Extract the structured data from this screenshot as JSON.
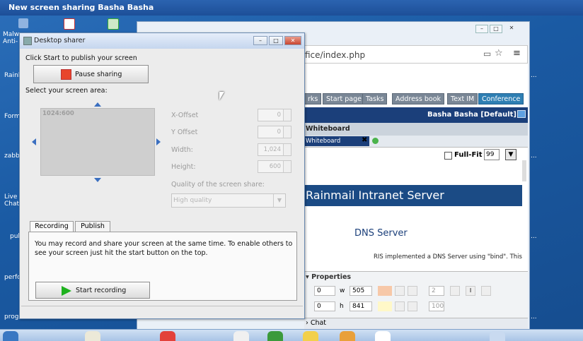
{
  "session_title": "New screen sharing  Basha Basha",
  "desktop": {
    "labels": [
      "Malw\nAnti-",
      "Rainl",
      "Form",
      "zabbi",
      "Live\nChat",
      "pul",
      "perfo",
      "proge"
    ]
  },
  "browser": {
    "url": "fice/index.php",
    "nav_tabs": [
      "rks",
      "Start page",
      "Tasks",
      "Address book",
      "Text IM",
      "Conference"
    ],
    "user": "Basha Basha [Default]",
    "whiteboard_header": "Whiteboard",
    "whiteboard_tab": "Whiteboard",
    "full_fit_label": "Full-Fit",
    "zoom_value": "99",
    "banner_text": "Rainmail Intranet Server",
    "section_title": "DNS Server",
    "body_line1": "RIS implemented a DNS Server using \"bind\". This",
    "properties_label": "Properties",
    "prop_x": "0",
    "prop_w_label": "w",
    "prop_w": "505",
    "prop_y": "0",
    "prop_h_label": "h",
    "prop_h": "841",
    "prop_size": "2",
    "prop_opacity": "100",
    "chat_label": "Chat"
  },
  "dialog": {
    "title": "Desktop sharer",
    "instruction": "Click Start to publish your screen",
    "pause_button": "Pause sharing",
    "select_area_label": "Select your screen area:",
    "preview_caption": "1024:600",
    "fields": [
      {
        "label": "X-Offset",
        "value": "0"
      },
      {
        "label": "Y Offset",
        "value": "0"
      },
      {
        "label": "Width:",
        "value": "1,024"
      },
      {
        "label": "Height:",
        "value": "600"
      }
    ],
    "quality_label": "Quality of the screen share:",
    "quality_value": "High quality",
    "tabs": [
      "Recording",
      "Publish"
    ],
    "recording_text": "You may record and share your screen at the same time. To enable others to see your screen just hit the start button on the top.",
    "start_recording": "Start recording"
  },
  "colors": {
    "pause_red": "#e8452c",
    "record_green": "#1fb21f",
    "banner_blue": "#1b4b85",
    "conference_tab": "#2f7fb3"
  }
}
